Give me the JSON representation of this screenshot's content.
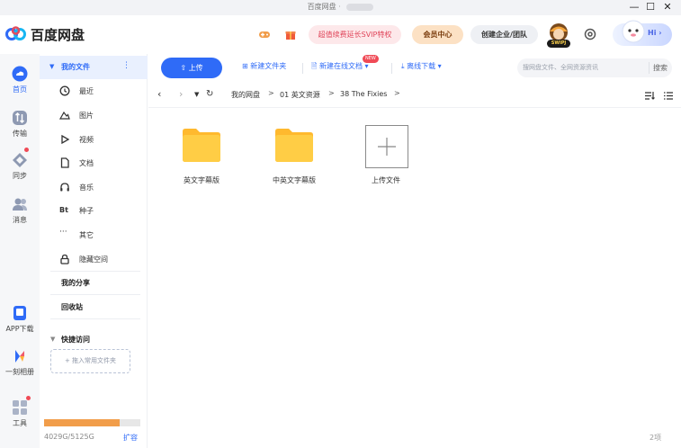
{
  "window": {
    "title": "百度网盘",
    "title_sep": "·",
    "minimize": "—",
    "maximize": "☐",
    "close": "✕"
  },
  "header": {
    "brand": "百度网盘",
    "promo": "超值续费延长SVIP特权",
    "vip_center": "会员中心",
    "enterprise": "创建企业/团队",
    "avatar_badge": "SWIPJ",
    "hi": "Hi",
    "hi_arrow": "›"
  },
  "rail": {
    "items": [
      {
        "label": "首页",
        "icon": "cloud-home-icon"
      },
      {
        "label": "传输",
        "icon": "transfer-icon"
      },
      {
        "label": "同步",
        "icon": "sync-icon"
      },
      {
        "label": "消息",
        "icon": "message-icon"
      },
      {
        "label": "APP下载",
        "icon": "app-download-icon"
      },
      {
        "label": "一刻相册",
        "icon": "album-icon"
      },
      {
        "label": "工具",
        "icon": "tools-icon"
      }
    ]
  },
  "nav": {
    "my_files": "我的文件",
    "more": "⋮",
    "items": [
      {
        "label": "最近",
        "icon": "clock-icon"
      },
      {
        "label": "图片",
        "icon": "image-icon"
      },
      {
        "label": "视频",
        "icon": "video-icon"
      },
      {
        "label": "文档",
        "icon": "document-icon"
      },
      {
        "label": "音乐",
        "icon": "music-icon"
      },
      {
        "label": "种子",
        "icon": "bt-icon",
        "glyph": "Bt"
      },
      {
        "label": "其它",
        "icon": "more-dots-icon"
      },
      {
        "label": "隐藏空间",
        "icon": "lock-icon"
      }
    ],
    "my_share": "我的分享",
    "recycle": "回收站",
    "quick_access": "快捷访问",
    "drag_hint": "+ 拖入常用文件夹",
    "storage_text": "4029G/5125G",
    "storage_used_fraction": 0.786,
    "expand": "扩容"
  },
  "toolbar": {
    "upload": "上传",
    "new_folder": "新建文件夹",
    "new_online_doc": "新建在线文档",
    "new_badge": "NEW",
    "offline_download": "离线下载",
    "search_placeholder": "搜网盘文件、全网资源资讯",
    "search_button": "搜索"
  },
  "path": {
    "back": "‹",
    "forward": "›",
    "crumbs": [
      "我的网盘",
      "01 英文资源",
      "38 The Fixies"
    ],
    "separator": ">"
  },
  "files": [
    {
      "name": "英文字幕版",
      "type": "folder"
    },
    {
      "name": "中英文字幕版",
      "type": "folder"
    },
    {
      "name": "上传文件",
      "type": "upload"
    }
  ],
  "status": {
    "count": "2项"
  },
  "colors": {
    "accent": "#2f6bf7",
    "folder": "#ffc83d",
    "storage_fill": "#f19d4a",
    "promo_text": "#e0455a"
  }
}
